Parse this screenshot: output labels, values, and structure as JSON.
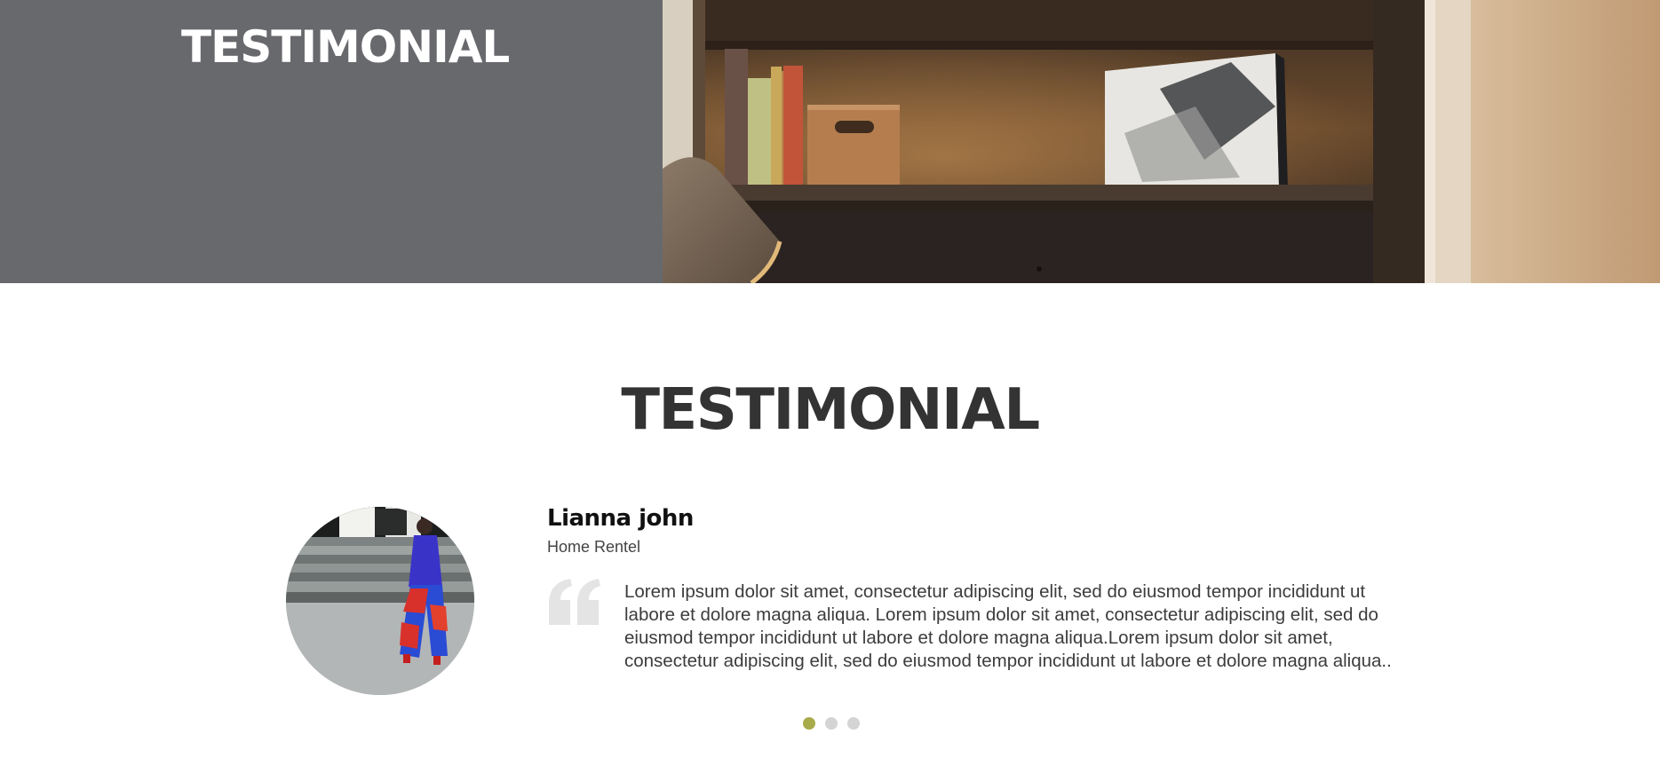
{
  "hero": {
    "title": "TESTIMONIAL"
  },
  "testimonial_section": {
    "title": "TESTIMONIAL",
    "items": [
      {
        "name": "Lianna john",
        "role": "Home Rentel",
        "quote": "Lorem ipsum dolor sit amet, consectetur adipiscing elit, sed do eiusmod tempor incididunt ut labore et dolore magna aliqua. Lorem ipsum dolor sit amet, consectetur adipiscing elit, sed do eiusmod tempor incididunt ut labore et dolore magna aliqua.Lorem ipsum dolor sit amet, consectetur adipiscing elit, sed do eiusmod tempor incididunt ut labore et dolore magna aliqua.."
      }
    ],
    "carousel": {
      "slide_count": 3,
      "active_index": 0
    }
  },
  "icons": {
    "quote": "quote-icon"
  },
  "colors": {
    "hero_panel": "#68696d",
    "heading_dark": "#333333",
    "dot_active": "#a8ab4a",
    "dot_inactive": "#d4d4d4",
    "quote_mark": "#e4e4e4"
  }
}
